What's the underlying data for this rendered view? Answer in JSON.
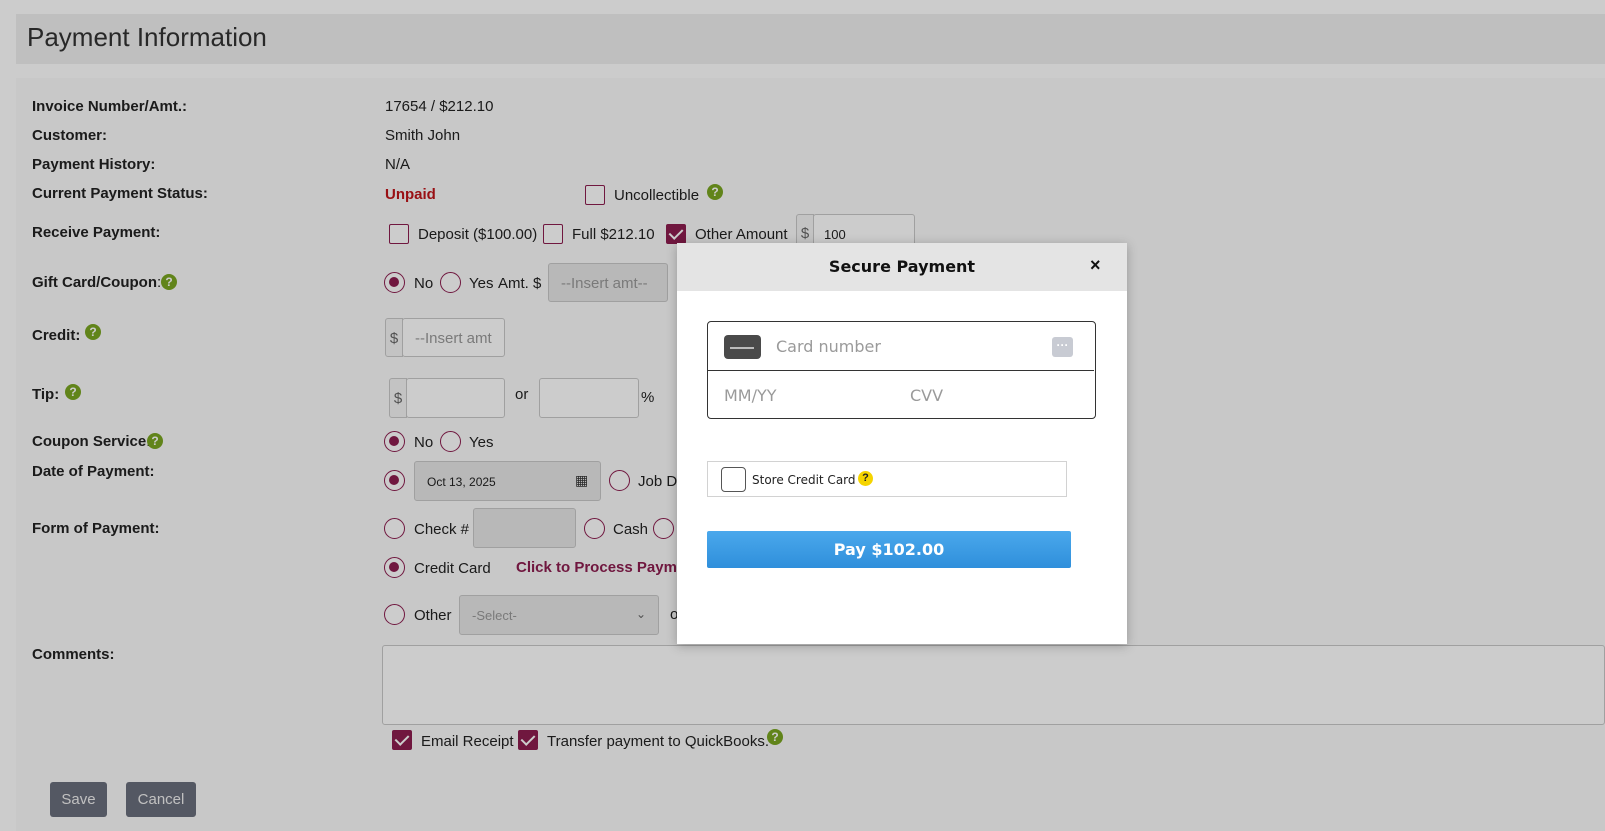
{
  "page": {
    "title": "Payment Information"
  },
  "form": {
    "invoice_label": "Invoice Number/Amt.:",
    "invoice_value": "17654 / $212.10",
    "customer_label": "Customer:",
    "customer_value": "Smith John",
    "history_label": "Payment History:",
    "history_value": "N/A",
    "status_label": "Current Payment Status:",
    "status_value": "Unpaid",
    "uncollectible_label": "Uncollectible",
    "uncollectible_checked": false,
    "receive_label": "Receive Payment:",
    "deposit_label": "Deposit ($100.00)",
    "deposit_checked": false,
    "full_label": "Full $212.10",
    "full_checked": false,
    "other_amount_label": "Other Amount",
    "other_amount_checked": true,
    "currency_symbol": "$",
    "other_amount_value": "100",
    "gift_label": "Gift Card/Coupon",
    "gift_colon": ":",
    "no_label": "No",
    "yes_label": "Yes",
    "gift_amt_label": "Amt. $",
    "gift_amt_placeholder": "--Insert amt--",
    "credit_label": "Credit:",
    "credit_placeholder": "--Insert amt",
    "tip_label": "Tip:",
    "tip_or": "or",
    "tip_percent": "%",
    "coupon_label": "Coupon Service",
    "coupon_colon": ":",
    "date_label": "Date of Payment:",
    "date_value": "Oct 13, 2025",
    "job_date_label": "Job Da",
    "form_label": "Form of Payment:",
    "check_label": "Check #",
    "cash_label": "Cash",
    "credit_card_label": "Credit Card",
    "process_link": "Click to Process Paymer",
    "other_label": "Other",
    "other_select": "-Select-",
    "other_trailing": "o",
    "comments_label": "Comments:",
    "email_receipt_label": "Email Receipt",
    "email_receipt_checked": true,
    "quickbooks_label": "Transfer payment to QuickBooks.",
    "quickbooks_checked": true,
    "save_label": "Save",
    "cancel_label": "Cancel",
    "help_glyph": "?"
  },
  "modal": {
    "title": "Secure Payment",
    "close_glyph": "×",
    "card_number_placeholder": "Card number",
    "expiry_placeholder": "MM/YY",
    "cvv_placeholder": "CVV",
    "store_card_label": "Store Credit Card",
    "store_card_checked": false,
    "help_glyph": "?",
    "pay_label": "Pay $102.00",
    "dots_glyph": "···"
  },
  "colors": {
    "accent": "#8c1d4f",
    "status_unpaid": "#c0151a",
    "help_green": "#7aa621",
    "pay_blue": "#3498e3",
    "button_gray": "#6a6e7c"
  }
}
